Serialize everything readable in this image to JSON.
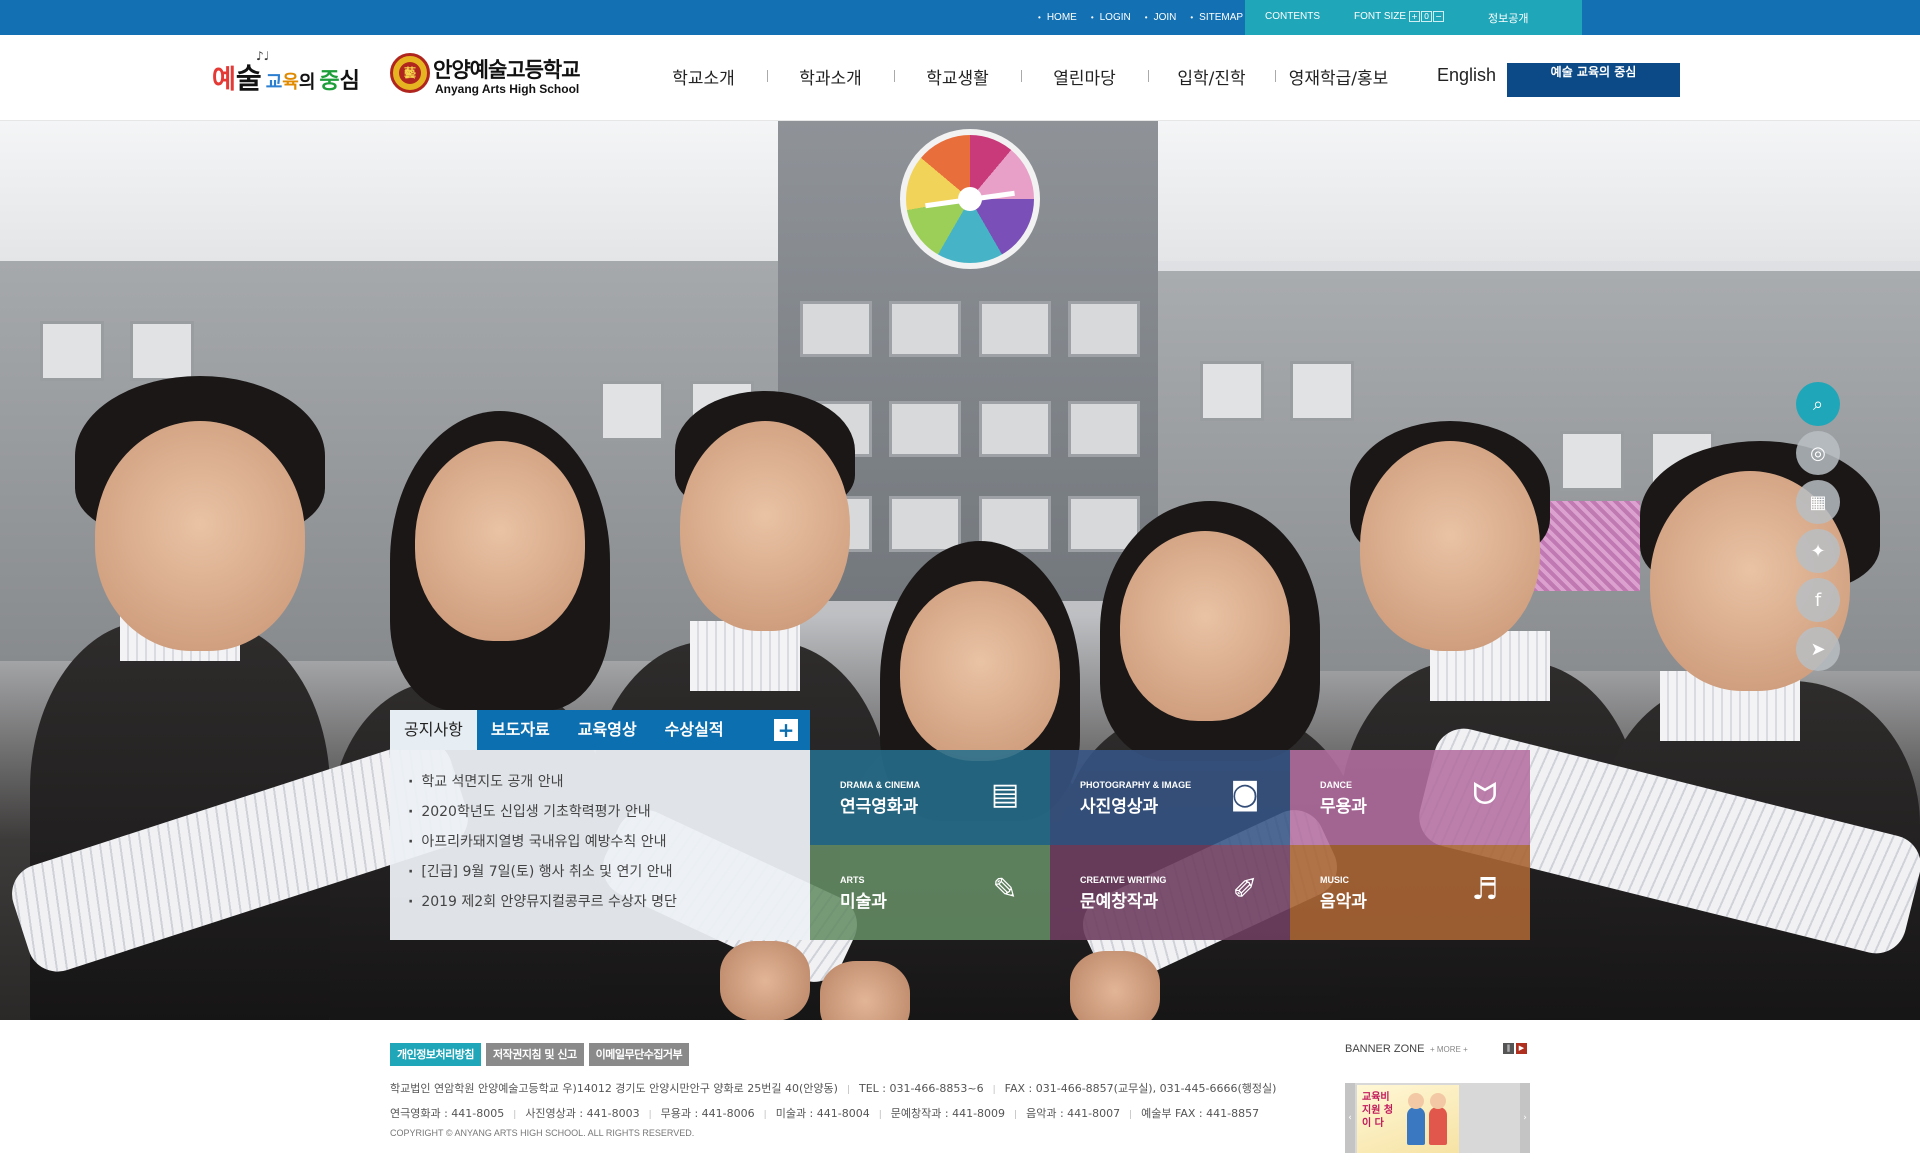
{
  "topbar": {
    "links": [
      "HOME",
      "LOGIN",
      "JOIN",
      "SITEMAP"
    ],
    "contents": "CONTENTS",
    "font_size_label": "FONT SIZE",
    "font_size_buttons": [
      "+",
      "0",
      "−"
    ],
    "info_disclosure": "정보공개"
  },
  "header": {
    "slogan_chars": [
      "예",
      "술",
      "교",
      "육",
      "의",
      "중",
      "심"
    ],
    "school_name_ko": "안양예술고등학교",
    "school_name_en": "Anyang Arts High School",
    "logo_mark": "藝",
    "nav": [
      "학교소개",
      "학과소개",
      "학교생활",
      "열린마당",
      "입학/진학",
      "영재학급/홍보"
    ],
    "english": "English",
    "slogan_button": "예술 교육의 중심"
  },
  "quick_menu": {
    "icons": [
      "search-icon",
      "film-reel-icon",
      "calendar-icon",
      "camera-tripod-icon",
      "facebook-icon",
      "paper-plane-icon"
    ],
    "symbols": [
      "⌕",
      "◎",
      "▦",
      "✦",
      "f",
      "➤"
    ]
  },
  "notice": {
    "tabs": [
      "공지사항",
      "보도자료",
      "교육영상",
      "수상실적"
    ],
    "more": "+",
    "items": [
      "학교 석면지도 공개 안내",
      "2020학년도 신입생 기초학력평가 안내",
      "아프리카돼지열병 국내유입 예방수칙 안내",
      "[긴급] 9월 7일(토) 행사 취소 및 연기 안내",
      "2019 제2회 안양뮤지컬콩쿠르 수상자 명단"
    ]
  },
  "departments": [
    {
      "en": "DRAMA & CINEMA",
      "ko": "연극영화과",
      "icon": "film-strip-icon",
      "symbol": "▤"
    },
    {
      "en": "PHOTOGRAPHY & IMAGE",
      "ko": "사진영상과",
      "icon": "camera-icon",
      "symbol": "◙"
    },
    {
      "en": "DANCE",
      "ko": "무용과",
      "icon": "ballet-shoes-icon",
      "symbol": "ᗢ"
    },
    {
      "en": "ARTS",
      "ko": "미술과",
      "icon": "palette-icon",
      "symbol": "✎"
    },
    {
      "en": "CREATIVE WRITING",
      "ko": "문예창작과",
      "icon": "pencil-icon",
      "symbol": "✐"
    },
    {
      "en": "MUSIC",
      "ko": "음악과",
      "icon": "piano-icon",
      "symbol": "♬"
    }
  ],
  "footer": {
    "buttons": [
      "개인정보처리방침",
      "저작권지침 및 신고",
      "이메일무단수집거부"
    ],
    "address": [
      "학교법인 연암학원 안양예술고등학교 우)14012 경기도 안양시만안구 양화로 25번길 40(안양동)",
      "TEL : 031-466-8853~6",
      "FAX : 031-466-8857(교무실), 031-445-6666(행정실)"
    ],
    "phones": [
      "연극영화과 : 441-8005",
      "사진영상과 : 441-8003",
      "무용과 : 441-8006",
      "미술과 : 441-8004",
      "문예창작과 : 441-8009",
      "음악과 : 441-8007",
      "예술부 FAX : 441-8857"
    ],
    "copyright": "COPYRIGHT © ANYANG ARTS HIGH SCHOOL. ALL RIGHTS RESERVED."
  },
  "banner_zone": {
    "title": "BANNER ZONE",
    "more": "+ MORE +",
    "banner_text": "교육비 지원 청이 다"
  },
  "colors": {
    "topbar": "#1371b3",
    "accent_teal": "#1fa6b8",
    "nav_button": "#0c4a87",
    "notice_tabs": "#0c6fb0"
  }
}
